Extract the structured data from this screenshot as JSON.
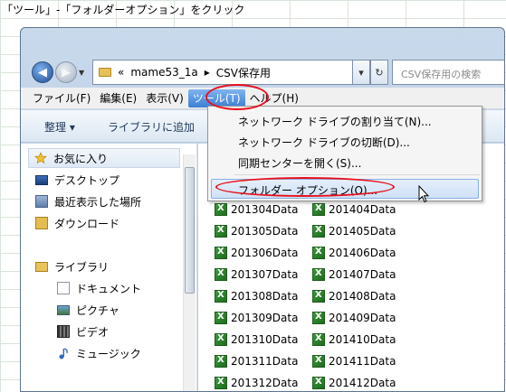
{
  "caption": "「ツール」-「フォルダーオプション」をクリック",
  "address": {
    "chevron": "«",
    "crumb1": "mame53_1a",
    "sep": "▸",
    "crumb2": "CSV保存用",
    "dropdown": "▾",
    "refresh": "↻",
    "search_placeholder": "CSV保存用の検索"
  },
  "menubar": {
    "items": [
      "ファイル(F)",
      "編集(E)",
      "表示(V)",
      "ツール(T)",
      "ヘルプ(H)"
    ]
  },
  "toolbar": {
    "organize": "整理 ▾",
    "library": "ライブラリに追加"
  },
  "nav": {
    "favorites": "お気に入り",
    "desktop": "デスクトップ",
    "recent": "最近表示した場所",
    "downloads": "ダウンロード",
    "libraries": "ライブラリ",
    "documents": "ドキュメント",
    "pictures": "ピクチャ",
    "videos": "ビデオ",
    "music": "ミュージック"
  },
  "files": {
    "col1": [
      "201304Data",
      "201305Data",
      "201306Data",
      "201307Data",
      "201308Data",
      "201309Data",
      "201310Data",
      "201311Data",
      "201312Data"
    ],
    "col2": [
      "201404Data",
      "201405Data",
      "201406Data",
      "201407Data",
      "201408Data",
      "201409Data",
      "201410Data",
      "201411Data",
      "201412Data"
    ]
  },
  "tools_menu": {
    "items": [
      "ネットワーク ドライブの割り当て(N)...",
      "ネットワーク ドライブの切断(D)...",
      "同期センターを開く(S)...",
      "フォルダー オプション(O)..."
    ]
  },
  "colors": {
    "highlight_oval": "#e8101c",
    "menu_active": "#3c7fd4"
  }
}
